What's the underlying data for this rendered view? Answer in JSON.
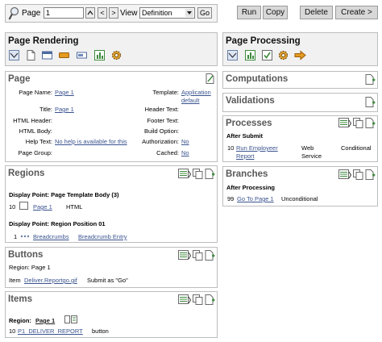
{
  "toolbar": {
    "page_label": "Page",
    "page_value": "1",
    "view_label": "View",
    "view_value": "Definition",
    "go_label": "Go",
    "run_label": "Run",
    "copy_label": "Copy",
    "delete_label": "Delete",
    "create_label": "Create >"
  },
  "page_rendering": {
    "title": "Page Rendering"
  },
  "page_processing": {
    "title": "Page Processing"
  },
  "page": {
    "title": "Page",
    "left": [
      {
        "label": "Page Name:",
        "value": "Page 1",
        "link": true
      },
      {
        "label": "Title:",
        "value": "Page 1",
        "link": true
      },
      {
        "label": "HTML Header:",
        "value": "",
        "link": false
      },
      {
        "label": "HTML Body:",
        "value": "",
        "link": false
      },
      {
        "label": "Help Text:",
        "value": "No help is available for this",
        "link": true
      },
      {
        "label": "Page Group:",
        "value": "",
        "link": false
      }
    ],
    "right": [
      {
        "label": "Template:",
        "value": "Application default",
        "link": true
      },
      {
        "label": "Header Text:",
        "value": "",
        "link": false
      },
      {
        "label": "Footer Text:",
        "value": "",
        "link": false
      },
      {
        "label": "Build Option:",
        "value": "",
        "link": false
      },
      {
        "label": "Authorization:",
        "value": "No",
        "link": true
      },
      {
        "label": "Cached:",
        "value": "No",
        "link": true
      }
    ]
  },
  "regions": {
    "title": "Regions",
    "display_point_1": "Display Point: Page Template Body (3)",
    "row1": {
      "seq": "10",
      "name": "Page 1",
      "type": "HTML"
    },
    "display_point_2": "Display Point: Region Position 01",
    "row2": {
      "seq": "1",
      "name": "Breadcrumbs",
      "type": "Breadcrumb Entry"
    }
  },
  "buttons": {
    "title": "Buttons",
    "region_label": "Region: Page 1",
    "item_label": "Item",
    "item_name": "Deliver.Reportgo.gif",
    "item_action": "Submit as \"Go\""
  },
  "items": {
    "title": "Items",
    "region_label": "Region:",
    "region_name": "Page 1",
    "item_seq": "10",
    "item_name": "P1_DELIVER_REPORT",
    "item_type": "button"
  },
  "computations": {
    "title": "Computations"
  },
  "validations": {
    "title": "Validations"
  },
  "processes": {
    "title": "Processes",
    "subtitle": "After Submit",
    "seq": "10",
    "name": "Run Employeer Report",
    "type": "Web Service",
    "cond": "Conditional"
  },
  "branches": {
    "title": "Branches",
    "subtitle": "After Processing",
    "seq": "99",
    "name": "Go To Page  1",
    "cond": "Unconditional"
  },
  "colors": {
    "panel_border": "#bdbdbd",
    "title_gray": "#585858",
    "link_blue": "#39538f",
    "button_gray": "#d8d8d8",
    "icon_green": "#3d8a3d",
    "icon_orange": "#e59a20"
  }
}
